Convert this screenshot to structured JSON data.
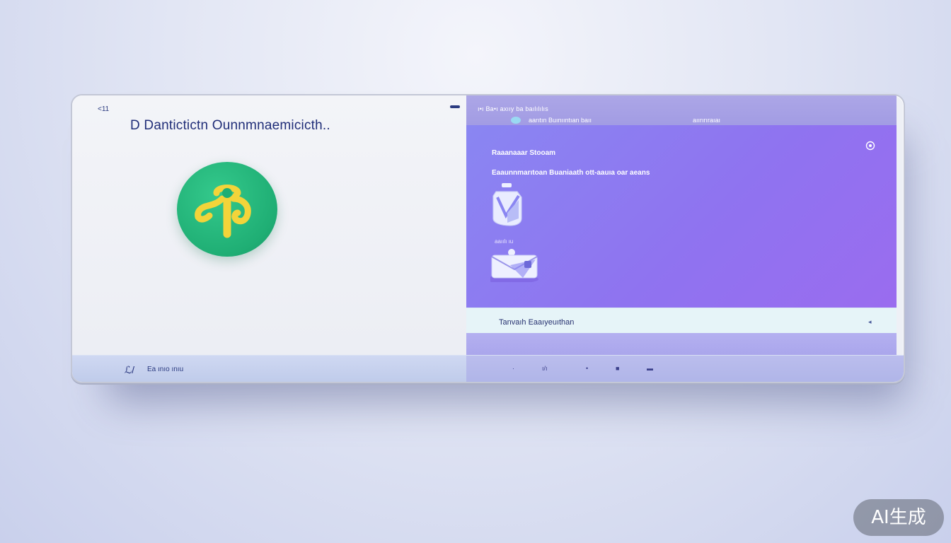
{
  "left": {
    "back_label": "<11",
    "title": "D Dantictictn Ounnmnaemicicth.."
  },
  "right": {
    "breadcrumb": "ı•ı  Ba•ı axııy ba baılılılıs",
    "status_text": "aarıtın  Buınııntıan baıı",
    "header_right": "aıırırıraıaı",
    "section_title": "Raaanaaar Stooam",
    "description": "Eaaunnmarıtoan Buaniaath ott-aauıa oar aeans",
    "item_label": "aaıılı ıu",
    "footer_label": "Tanvaıh Eaaıyeuıthan",
    "footer_icon": "◂"
  },
  "bottom": {
    "left_label": "Ea ınıo ınıu",
    "left_icon": "ℒ/",
    "controls": [
      "·",
      "ı/ı",
      "•",
      "■",
      "▬"
    ]
  },
  "watermark": "AI生成",
  "colors": {
    "accent": "#8f73f0",
    "badge": "#1fae74",
    "badge_glyph": "#f3d43a"
  },
  "icons": {
    "badge": "fork-glyph-icon",
    "settings": "settings-icon",
    "item1": "jar-shield-icon",
    "item2": "envelope-icon"
  }
}
